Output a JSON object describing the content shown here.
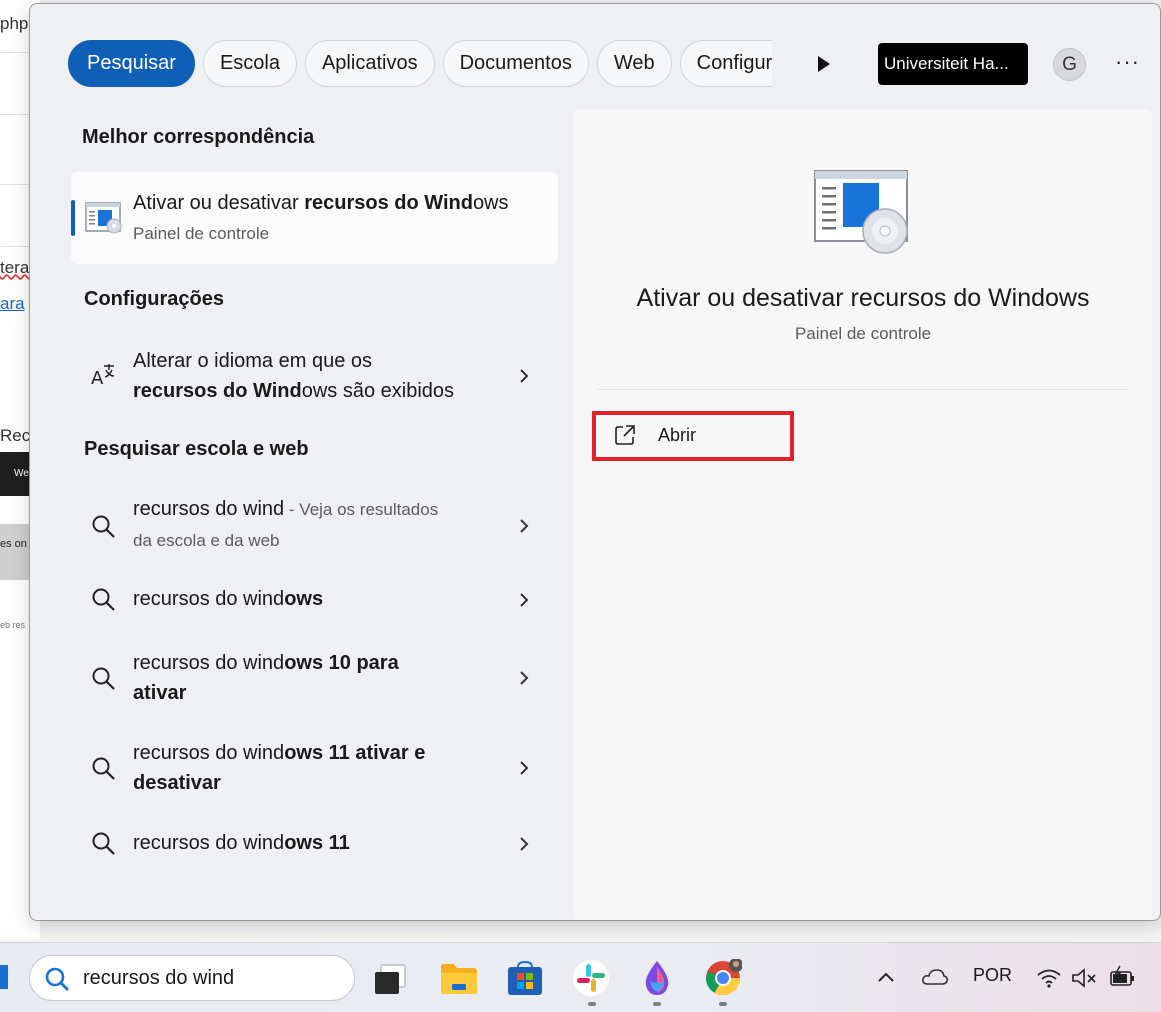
{
  "background_window": {
    "fragments": [
      "php",
      "tera",
      "ara",
      "Recu",
      "We",
      "es on",
      "eb res"
    ]
  },
  "filters": {
    "tabs": [
      "Pesquisar",
      "Escola",
      "Aplicativos",
      "Documentos",
      "Web",
      "Configur"
    ],
    "org_name": "Universiteit Ha...",
    "avatar_letter": "G",
    "more": "···"
  },
  "best_match": {
    "section_title": "Melhor correspondência",
    "title_pre": "Ativar ou desativar ",
    "title_bold": "recursos do Wind",
    "title_post": "ows",
    "subtitle": "Painel de controle"
  },
  "settings": {
    "section_title": "Configurações",
    "item": {
      "line1": "Alterar o idioma em que os",
      "line2_bold": "recursos do Wind",
      "line2_rest": "ows são exibidos"
    }
  },
  "web": {
    "section_title": "Pesquisar escola e web",
    "results": [
      {
        "pre": "recursos do wind",
        "bold": "",
        "line2": "",
        "suffix": " - Veja os resultados",
        "suffix2": "da escola e da web"
      },
      {
        "pre": "recursos do wind",
        "bold": "ows",
        "line2": "",
        "suffix": "",
        "suffix2": ""
      },
      {
        "pre": "recursos do wind",
        "bold": "ows 10 para",
        "line2": "ativar",
        "suffix": "",
        "suffix2": ""
      },
      {
        "pre": "recursos do wind",
        "bold": "ows 11 ativar e",
        "line2": "desativar",
        "suffix": "",
        "suffix2": ""
      },
      {
        "pre": "recursos do wind",
        "bold": "ows 11",
        "line2": "",
        "suffix": "",
        "suffix2": ""
      }
    ]
  },
  "preview": {
    "title": "Ativar ou desativar recursos do Windows",
    "subtitle": "Painel de controle",
    "open_label": "Abrir"
  },
  "taskbar": {
    "search_value": "recursos do wind",
    "language": "POR",
    "apps": [
      "task-view",
      "file-explorer",
      "microsoft-store",
      "slack",
      "paint",
      "chrome"
    ]
  },
  "colors": {
    "accent": "#0f5fb7",
    "highlight_box": "#e0202a"
  }
}
